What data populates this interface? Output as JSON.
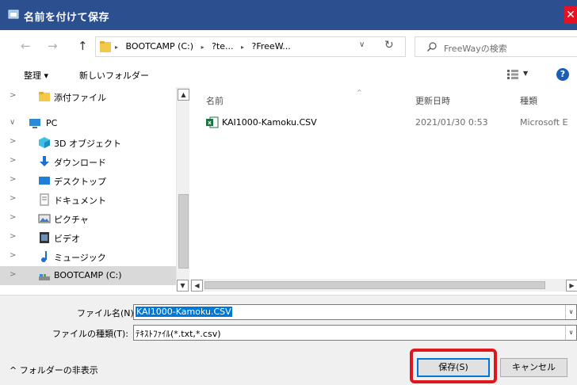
{
  "window": {
    "title": "名前を付けて保存",
    "close_glyph": "✕"
  },
  "address": {
    "back_glyph": "←",
    "forward_glyph": "→",
    "up_glyph": "↑",
    "crumbs": [
      "BOOTCAMP (C:)",
      "?te...",
      "?FreeW..."
    ],
    "crumb_sep": "▸",
    "dropdown_glyph": "∨",
    "refresh_glyph": "↻"
  },
  "search": {
    "placeholder": "FreeWayの検索"
  },
  "toolbar": {
    "organize_label": "整理 ▾",
    "new_folder_label": "新しいフォルダー",
    "view_dropdown_glyph": "▼",
    "help_glyph": "?"
  },
  "nav": {
    "items": [
      {
        "label": "添付ファイル",
        "icon": "folder-icon"
      },
      {
        "label": "PC",
        "icon": "computer-icon"
      },
      {
        "label": "3D オブジェクト",
        "icon": "cube-icon"
      },
      {
        "label": "ダウンロード",
        "icon": "download-icon"
      },
      {
        "label": "デスクトップ",
        "icon": "desktop-icon"
      },
      {
        "label": "ドキュメント",
        "icon": "document-icon"
      },
      {
        "label": "ピクチャ",
        "icon": "picture-icon"
      },
      {
        "label": "ビデオ",
        "icon": "video-icon"
      },
      {
        "label": "ミュージック",
        "icon": "music-icon"
      },
      {
        "label": "BOOTCAMP (C:)",
        "icon": "drive-icon"
      }
    ],
    "chev_collapsed": ">",
    "chev_expanded": "∨"
  },
  "scroll": {
    "up_glyph": "▲",
    "down_glyph": "▼",
    "left_glyph": "◀",
    "right_glyph": "▶"
  },
  "files": {
    "columns": [
      "名前",
      "更新日時",
      "種類"
    ],
    "sort_glyph": "^",
    "rows": [
      {
        "name": "KAI1000-Kamoku.CSV",
        "date": "2021/01/30 0:53",
        "type": "Microsoft E"
      }
    ]
  },
  "form": {
    "filename_label": "ファイル名(N):",
    "filename_value": "KAI1000-Kamoku.CSV",
    "filetype_label": "ファイルの種類(T):",
    "filetype_value": "ﾃｷｽﾄﾌｧｲﾙ(*.txt,*.csv)",
    "dropdown_glyph": "∨",
    "hide_folders_label": "^ フォルダーの非表示",
    "save_label": "保存(S)",
    "cancel_label": "キャンセル"
  },
  "colors": {
    "titlebar": "#2b4f8f",
    "accent": "#0078d7",
    "highlight": "#e0161e",
    "close": "#e81123"
  }
}
